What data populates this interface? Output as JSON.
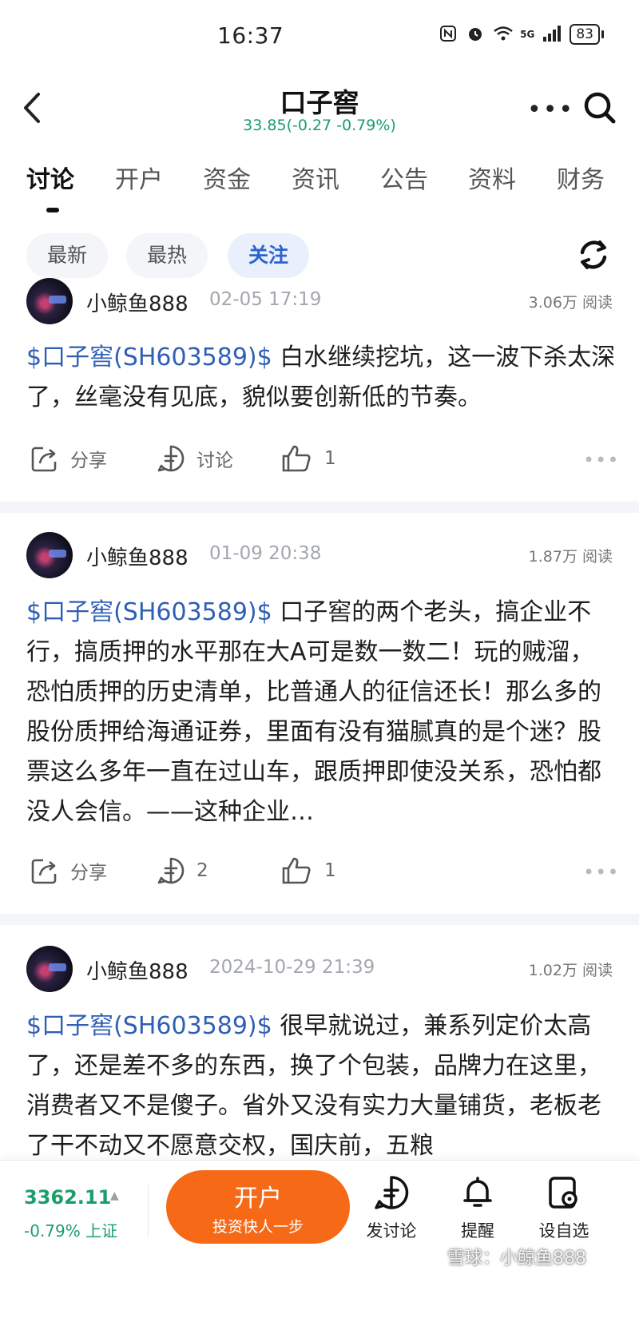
{
  "status_bar": {
    "time": "16:37",
    "network": "5G",
    "battery": "83"
  },
  "header": {
    "title": "口子窖",
    "price_line": "33.85(-0.27 -0.79%)",
    "icons": [
      "back-icon",
      "more-icon",
      "search-icon"
    ]
  },
  "tabs": [
    "讨论",
    "开户",
    "资金",
    "资讯",
    "公告",
    "资料",
    "财务"
  ],
  "filters": [
    "最新",
    "最热",
    "关注"
  ],
  "posts": [
    {
      "author": "小鲸鱼888",
      "time": "02-05 17:19",
      "reads": "3.06万 阅读",
      "stock": "$口子窖(SH603589)$",
      "text": " 白水继续挖坑，这一波下杀太深了，丝毫没有见底，貌似要创新低的节奏。",
      "share_label": "分享",
      "comment_label": "讨论",
      "likes": "1"
    },
    {
      "author": "小鲸鱼888",
      "time": "01-09 20:38",
      "reads": "1.87万 阅读",
      "stock": "$口子窖(SH603589)$",
      "text": " 口子窖的两个老头，搞企业不行，搞质押的水平那在大A可是数一数二！玩的贼溜，恐怕质押的历史清单，比普通人的征信还长！那么多的股份质押给海通证券，里面有没有猫腻真的是个迷？股票这么多年一直在过山车，跟质押即使没关系，恐怕都没人会信。——这种企业…",
      "share_label": "分享",
      "comment_label": "2",
      "likes": "1"
    },
    {
      "author": "小鲸鱼888",
      "time": "2024-10-29 21:39",
      "reads": "1.02万 阅读",
      "stock": "$口子窖(SH603589)$",
      "text": " 很早就说过，兼系列定价太高了，还是差不多的东西，换了个包装，品牌力在这里，消费者又不是傻子。省外又没有实力大量铺货，老板老了干不动又不愿意交权，国庆前，五粮"
    }
  ],
  "bottom_bar": {
    "index_value": "3362.11",
    "index_change": "-0.79% 上证",
    "open_account_title": "开户",
    "open_account_sub": "投资快人一步",
    "nav": [
      "发讨论",
      "提醒",
      "设自选"
    ]
  },
  "watermark": "雪球：小鲸鱼888",
  "colors": {
    "down_green": "#1a9e6a",
    "link_blue": "#2f5fb5",
    "accent_orange": "#f66a17",
    "chip_active_blue": "#2b63d4"
  }
}
